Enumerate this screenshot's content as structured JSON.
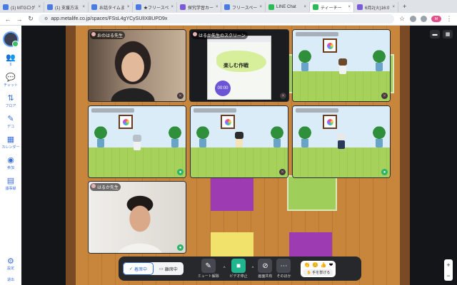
{
  "browser": {
    "tabs": [
      {
        "label": "(1) MTGログ",
        "color": "#4a7be0"
      },
      {
        "label": "(1) 支援方法",
        "color": "#4a7be0"
      },
      {
        "label": "お話タイムま",
        "color": "#4a7be0"
      },
      {
        "label": "★フリースペ",
        "color": "#4a7be0"
      },
      {
        "label": "探究学習カー",
        "color": "#7a5ad6"
      },
      {
        "label": "フリースペー",
        "color": "#4a7be0"
      },
      {
        "label": "LINE Chat",
        "color": "#2dbb55"
      },
      {
        "label": "ティーチー",
        "color": "#2dbb55"
      },
      {
        "label": "6月2(火)16:0",
        "color": "#7a5ad6"
      }
    ],
    "url": "app.metalife.co.jp/spaces/FSsL4gYCySUlIXBUPD9x",
    "profile_badge": "M"
  },
  "sidebar": {
    "items": [
      {
        "icon": "users-icon",
        "label": "6"
      },
      {
        "icon": "chat-icon",
        "label": "チャット"
      },
      {
        "icon": "floor-icon",
        "label": "フロア"
      },
      {
        "icon": "decor-icon",
        "label": "デコ"
      },
      {
        "icon": "calendar-icon",
        "label": "カレンダー"
      },
      {
        "icon": "members-icon",
        "label": "参加"
      },
      {
        "icon": "roster-icon",
        "label": "議事録"
      }
    ],
    "settings_label": "設定",
    "exit_label": "退出"
  },
  "tiles": {
    "t1_label": "おのはる先生",
    "t2_label": "はるか先生のスクリーン",
    "t7_label": "はるか先生",
    "slide_title": "楽しむ作戦",
    "slide_timer": "00:00"
  },
  "toolbar": {
    "status_on": "着席中",
    "status_off": "離席中",
    "mute_label": "ミュート解除",
    "video_label": "ビデオ停止",
    "share_label": "画面共有",
    "more_label": "そのほか",
    "raise_hand": "手を挙げる"
  },
  "colors": {
    "accent": "#2e6bd8",
    "toolbar_bg": "#26282c",
    "green_room": "#9fcf5a"
  }
}
